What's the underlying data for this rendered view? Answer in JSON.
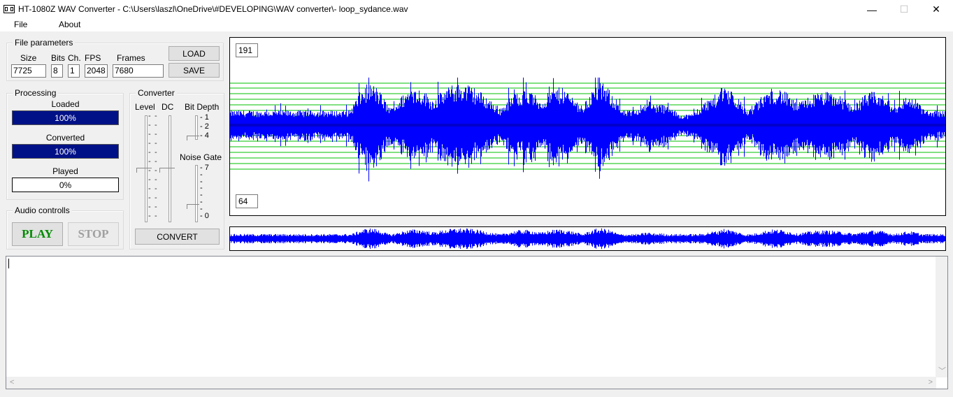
{
  "window": {
    "title": "HT-1080Z WAV Converter - C:\\Users\\laszl\\OneDrive\\#DEVELOPING\\WAV converter\\- loop_sydance.wav",
    "minimize_glyph": "—",
    "maximize_glyph": "☐",
    "close_glyph": "✕"
  },
  "menu": {
    "file": "File",
    "about": "About"
  },
  "file_parameters": {
    "title": "File parameters",
    "size_label": "Size",
    "size_value": "7725",
    "bits_label": "Bits",
    "bits_value": "8",
    "ch_label": "Ch.",
    "ch_value": "1",
    "fps_label": "FPS",
    "fps_value": "2048",
    "frames_label": "Frames",
    "frames_value": "7680",
    "load_label": "LOAD",
    "save_label": "SAVE"
  },
  "processing": {
    "title": "Processing",
    "loaded_label": "Loaded",
    "loaded_text": "100%",
    "loaded_fraction": 1.0,
    "converted_label": "Converted",
    "converted_text": "100%",
    "converted_fraction": 1.0,
    "played_label": "Played",
    "played_text": "0%",
    "played_fraction": 0.0
  },
  "converter": {
    "title": "Converter",
    "level_label": "Level",
    "dc_label": "DC",
    "bit_depth_label": "Bit Depth",
    "bit_depth_ticks": [
      "1",
      "2",
      "4"
    ],
    "noise_gate_label": "Noise Gate",
    "noise_gate_max": "7",
    "noise_gate_min": "0",
    "convert_label": "CONVERT"
  },
  "audio": {
    "title": "Audio controlls",
    "play_label": "PLAY",
    "stop_label": "STOP"
  },
  "waveform": {
    "upper_value": "191",
    "lower_value": "64"
  },
  "colors": {
    "wave": "#0000ff",
    "level_lines": "#00c000",
    "progress": "#001187",
    "play": "#008a00"
  },
  "icons": [
    "app-icon",
    "minimize-icon",
    "maximize-icon",
    "close-icon",
    "scroll-left-icon",
    "scroll-right-icon",
    "scroll-down-icon"
  ]
}
